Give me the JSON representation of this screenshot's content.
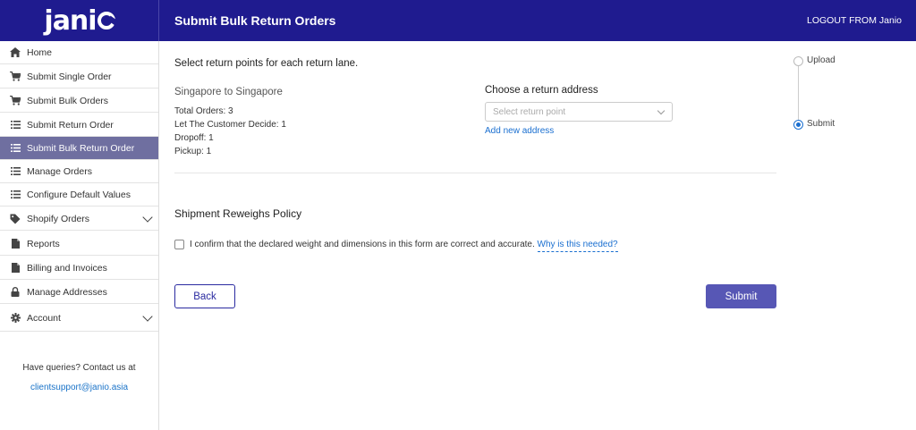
{
  "app": {
    "logo_text": "jani",
    "title": "Submit Bulk Return Orders",
    "logout": "LOGOUT FROM Janio",
    "brand_color": "#1f1b8f"
  },
  "sidebar": {
    "items": [
      {
        "label": "Home",
        "icon": "home-icon"
      },
      {
        "label": "Submit Single Order",
        "icon": "cart-icon"
      },
      {
        "label": "Submit Bulk Orders",
        "icon": "cart-icon"
      },
      {
        "label": "Submit Return Order",
        "icon": "list-icon"
      },
      {
        "label": "Submit Bulk Return Order",
        "icon": "list-icon",
        "active": true
      },
      {
        "label": "Manage Orders",
        "icon": "list-icon"
      },
      {
        "label": "Configure Default Values",
        "icon": "list-icon"
      },
      {
        "label": "Shopify Orders",
        "icon": "tag-icon",
        "expandable": true
      },
      {
        "label": "Reports",
        "icon": "document-icon"
      },
      {
        "label": "Billing and Invoices",
        "icon": "document-icon"
      },
      {
        "label": "Manage Addresses",
        "icon": "lock-icon"
      },
      {
        "label": "Account",
        "icon": "gear-icon",
        "expandable": true
      }
    ],
    "contact_text": "Have queries? Contact us at",
    "contact_email": "clientsupport@janio.asia"
  },
  "main": {
    "instruction": "Select return points for each return lane.",
    "lane": {
      "title": "Singapore to Singapore",
      "total_orders": "Total Orders: 3",
      "let_customer_decide": "Let The Customer Decide: 1",
      "dropoff": "Dropoff: 1",
      "pickup": "Pickup: 1"
    },
    "return_address": {
      "label": "Choose a return address",
      "placeholder": "Select return point",
      "add_link": "Add new address"
    },
    "policy": {
      "title": "Shipment Reweighs Policy",
      "confirm_text": "I confirm that the declared weight and dimensions in this form are correct and accurate.",
      "why_link": "Why is this needed?",
      "checked": false
    },
    "buttons": {
      "back": "Back",
      "submit": "Submit"
    }
  },
  "stepper": {
    "steps": [
      {
        "label": "Upload",
        "active": false
      },
      {
        "label": "Submit",
        "active": true
      }
    ]
  }
}
